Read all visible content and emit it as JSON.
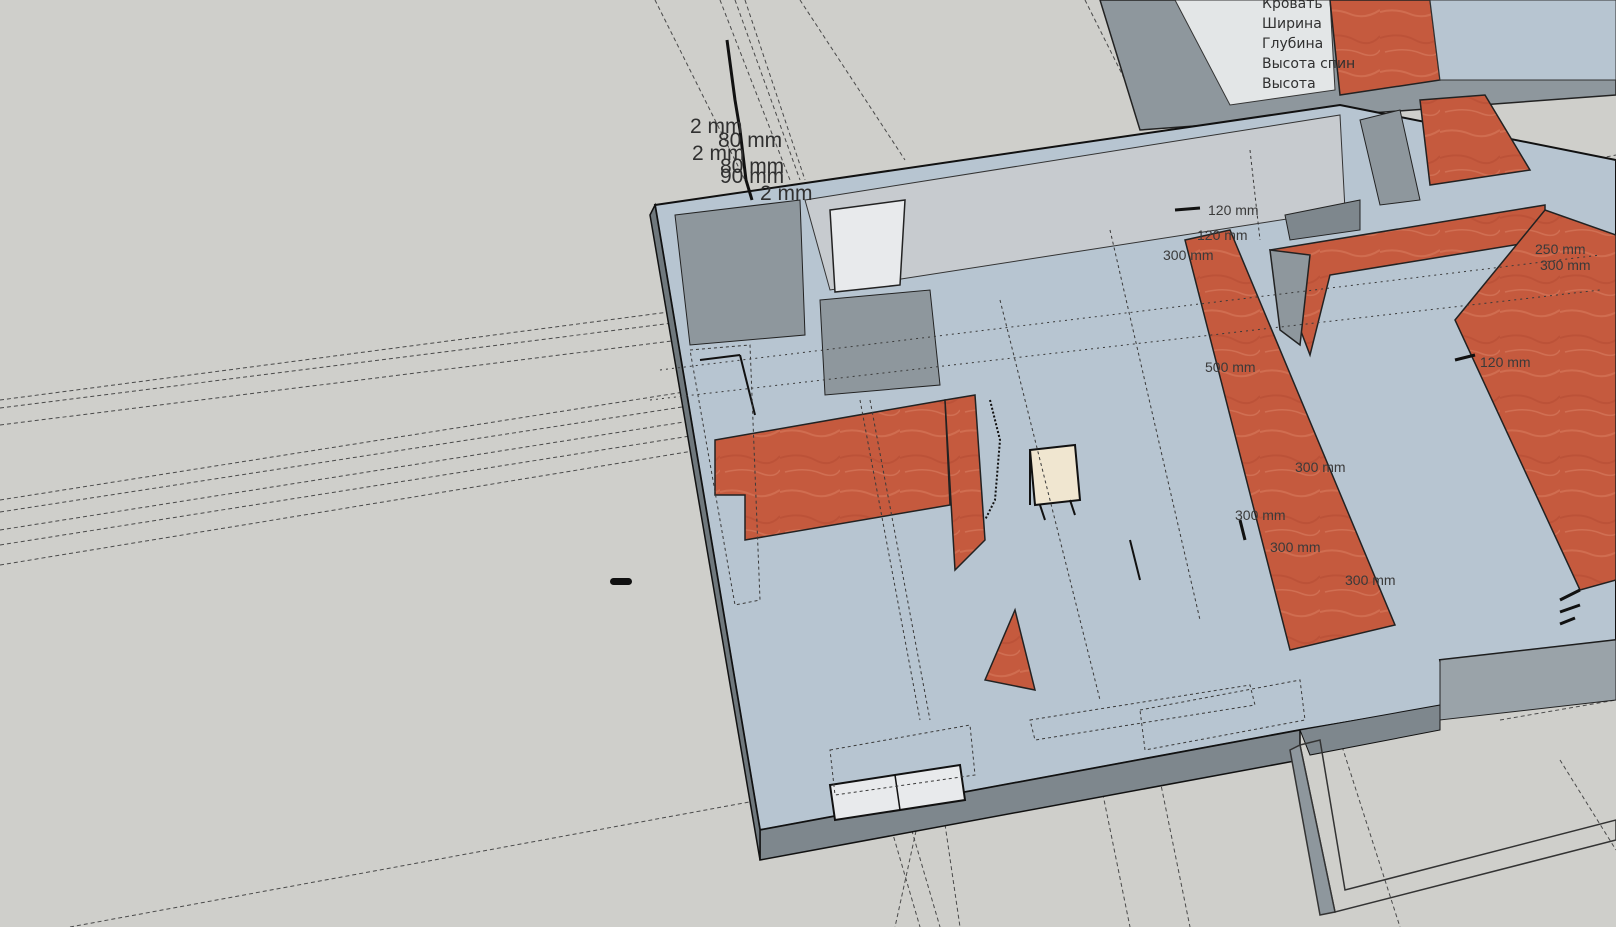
{
  "viewport": {
    "background": "#cfcfcb",
    "floor_color": "#b7c5d1",
    "wall_color": "#8e979d",
    "textured_wall_color": "#c55a3e"
  },
  "dimensions_upper": [
    "2 mm",
    "80 mm",
    "2 mm",
    "80 mm",
    "90 mm",
    "2 mm"
  ],
  "dimensions_plan": [
    "120 mm",
    "120 mm",
    "300 mm",
    "250 mm",
    "300 mm",
    "300 mm",
    "300 mm",
    "300 mm",
    "300 mm",
    "500 mm",
    "120 mm"
  ],
  "properties": [
    "Кровать",
    "Ширина",
    "Глубина",
    "Высота спин",
    "Высота"
  ]
}
